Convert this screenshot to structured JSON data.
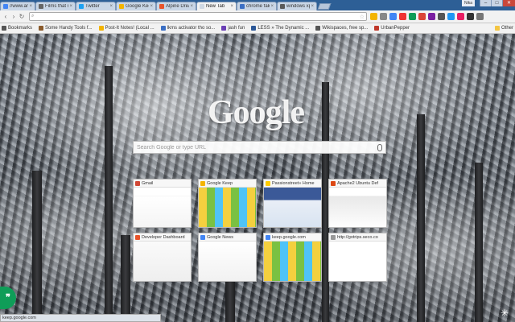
{
  "tabs": [
    {
      "label": "//www.andr",
      "color": "#4285f4"
    },
    {
      "label": "Films that magn",
      "color": "#666666"
    },
    {
      "label": "Twitter",
      "color": "#1da1f2"
    },
    {
      "label": "Google Keep",
      "color": "#f4b400"
    },
    {
      "label": "Alpine Dreams -",
      "color": "#e8542b"
    },
    {
      "label": "New Tab",
      "color": "#cfd8e3",
      "active": true
    },
    {
      "label": "chrome fake rec",
      "color": "#3b6fc4"
    },
    {
      "label": "windows xp - Su",
      "color": "#5a5a5a"
    }
  ],
  "window": {
    "user": "Nika"
  },
  "omnibox": {
    "value": "",
    "placeholder": ""
  },
  "bookmarks": [
    {
      "label": "Bookmarks",
      "color": "#555555"
    },
    {
      "label": "Some Handy Tools f...",
      "color": "#8a5a2b"
    },
    {
      "label": "Post-It Notes! (Local ...",
      "color": "#f4b400"
    },
    {
      "label": "lkms activator tho so...",
      "color": "#3b6fc4"
    },
    {
      "label": "jash fun",
      "color": "#6a3fb5"
    },
    {
      "label": "LESS » The Dynamic ...",
      "color": "#2b5797"
    },
    {
      "label": "Wikispaces, free sp...",
      "color": "#555555"
    },
    {
      "label": "UrbanPepper",
      "color": "#c0392b"
    }
  ],
  "other_bookmarks": "Other",
  "logo": "Google",
  "search": {
    "placeholder": "Search Google or type URL"
  },
  "tiles": [
    {
      "title": "Gmail",
      "color": "#d14836"
    },
    {
      "title": "Google Keep",
      "color": "#f4b400"
    },
    {
      "title": "Passionstreet» Home",
      "color": "#ffcc00"
    },
    {
      "title": "Apache2 Ubuntu Def",
      "color": "#dd4814"
    },
    {
      "title": "Developer Dashboard",
      "color": "#e8542b"
    },
    {
      "title": "Google News",
      "color": "#4285f4"
    },
    {
      "title": "keep.google.com",
      "color": "#4285f4"
    },
    {
      "title": "http://gotrips.seco.co",
      "color": "#999999"
    }
  ],
  "status": "keep.google.com",
  "hangouts": "❞"
}
